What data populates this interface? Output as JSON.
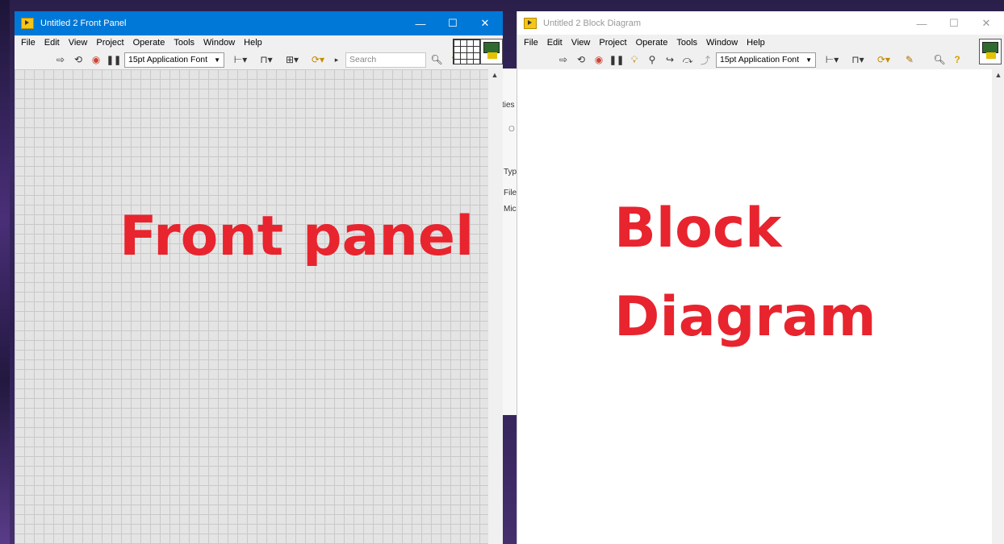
{
  "front_panel": {
    "title": "Untitled 2 Front Panel",
    "menu": [
      "File",
      "Edit",
      "View",
      "Project",
      "Operate",
      "Tools",
      "Window",
      "Help"
    ],
    "font": "15pt Application Font",
    "search_placeholder": "Search",
    "label": "Front panel",
    "accent": "#0078d7"
  },
  "block_diagram": {
    "title": "Untitled 2 Block Diagram",
    "menu": [
      "File",
      "Edit",
      "View",
      "Project",
      "Operate",
      "Tools",
      "Window",
      "Help"
    ],
    "font": "15pt Application Font",
    "label_line1": "Block",
    "label_line2": "Diagram"
  },
  "background_window": {
    "snippets": [
      "ties",
      "O",
      "Typ",
      "File",
      "Mic"
    ]
  },
  "window_controls": {
    "minimize": "—",
    "maximize": "☐",
    "close": "✕"
  },
  "label_color": "#e8242e"
}
